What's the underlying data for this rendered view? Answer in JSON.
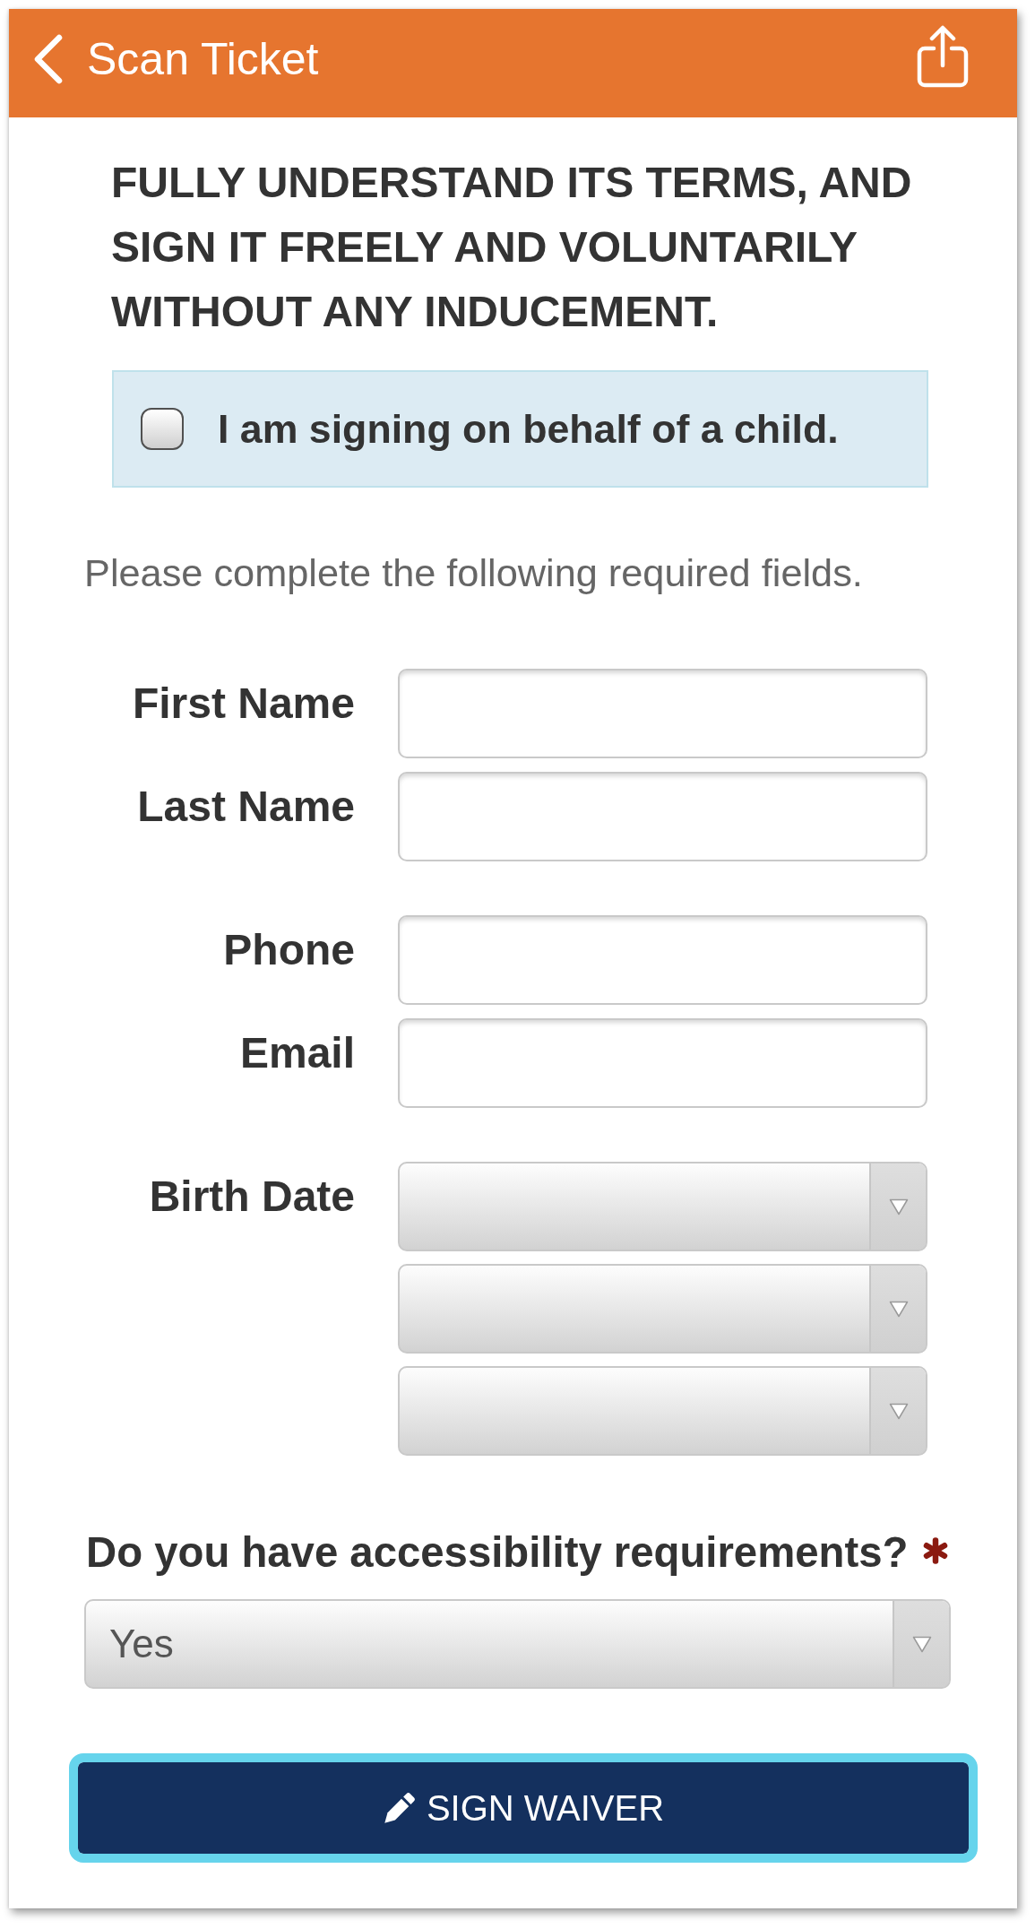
{
  "header": {
    "back_label": "Scan Ticket"
  },
  "agreement": {
    "text": "FULLY UNDERSTAND ITS TERMS, AND SIGN IT FREELY AND VOLUNTARILY WITHOUT ANY INDUCEMENT."
  },
  "child_checkbox": {
    "label": "I am signing on behalf of a child.",
    "checked": false
  },
  "instructions": "Please complete the following required fields.",
  "field_groups": [
    {
      "fields": [
        {
          "label": "First Name",
          "kind": "text"
        },
        {
          "label": "Last Name",
          "kind": "text"
        }
      ]
    },
    {
      "fields": [
        {
          "label": "Phone",
          "kind": "text"
        },
        {
          "label": "Email",
          "kind": "text"
        }
      ]
    },
    {
      "fields": [
        {
          "label": "Birth Date",
          "kind": "date"
        }
      ]
    }
  ],
  "accessibility": {
    "question": "Do you have accessibility requirements?",
    "required": true,
    "value": "Yes"
  },
  "submit_button": {
    "label": "SIGN WAIVER",
    "focused": true
  }
}
